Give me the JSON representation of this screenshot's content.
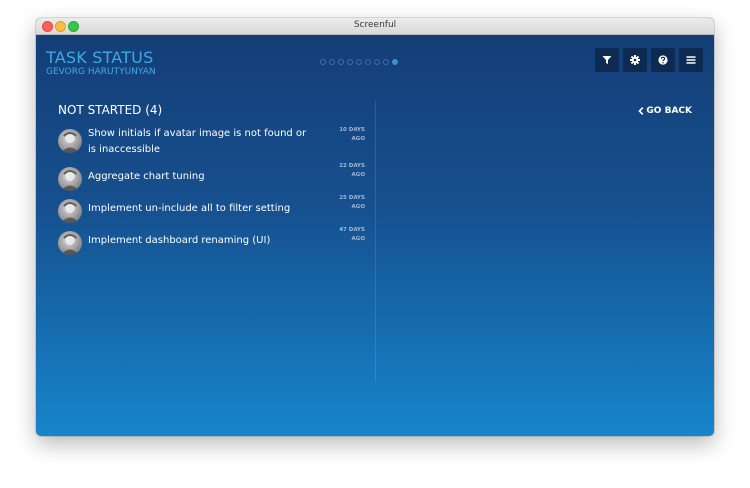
{
  "window": {
    "title": "Screenful"
  },
  "header": {
    "title": "TASK STATUS",
    "subtitle": "GEVORG HARUTYUNYAN",
    "pager": {
      "total": 9,
      "active_index": 8
    },
    "toolbar": {
      "filter_icon": "filter-icon",
      "settings_icon": "gear-icon",
      "help_icon": "help-icon",
      "menu_icon": "hamburger-menu-icon"
    }
  },
  "section": {
    "title": "NOT STARTED (4)",
    "go_back_label": "GO BACK"
  },
  "tasks": [
    {
      "title": "Show initials if avatar image is not found or is inaccessible",
      "age_line1": "10 DAYS",
      "age_line2": "AGO"
    },
    {
      "title": "Aggregate chart tuning",
      "age_line1": "22 DAYS",
      "age_line2": "AGO"
    },
    {
      "title": "Implement un-include all to filter setting",
      "age_line1": "25 DAYS",
      "age_line2": "AGO"
    },
    {
      "title": "Implement dashboard renaming (UI)",
      "age_line1": "47 DAYS",
      "age_line2": "AGO"
    }
  ],
  "colors": {
    "accent": "#3fa9e6",
    "bg_top": "#143c73",
    "bg_bottom": "#1785cb",
    "button_bg": "#0e2a50"
  }
}
